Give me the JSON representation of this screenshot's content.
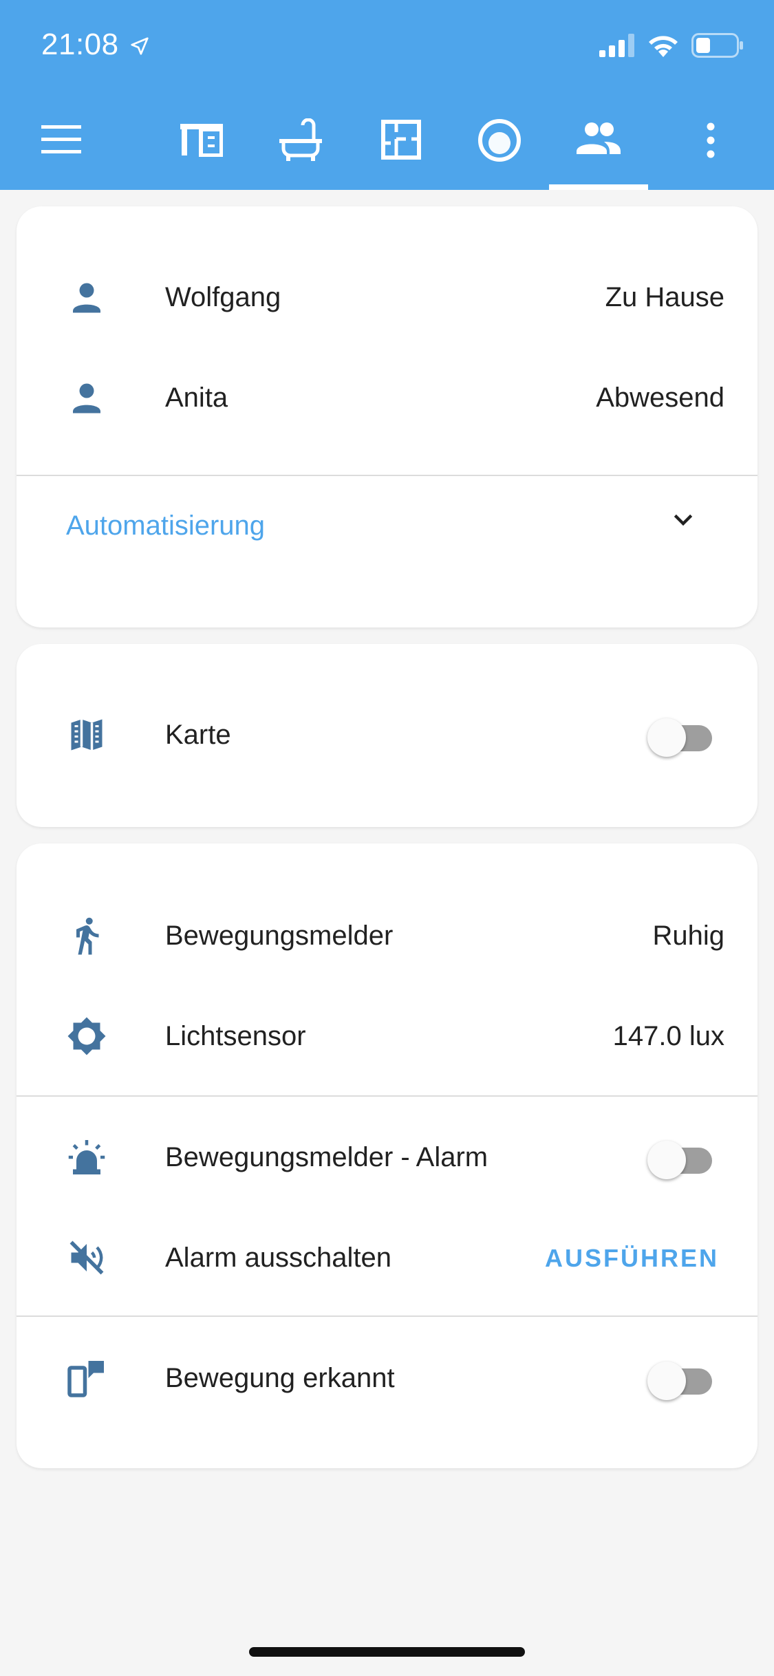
{
  "status_bar": {
    "time": "21:08"
  },
  "colors": {
    "header": "#4ea5eb",
    "icon": "#44739e",
    "accent": "#4ea5eb"
  },
  "toolbar": {
    "icons": [
      "menu-icon",
      "desk-icon",
      "bathtub-icon",
      "floorplan-icon",
      "robot-vacuum-icon",
      "people-icon",
      "more-vert-icon"
    ],
    "active_tab": "people-icon"
  },
  "card_people": {
    "rows": [
      {
        "label": "Wolfgang",
        "value": "Zu Hause",
        "icon": "person-icon"
      },
      {
        "label": "Anita",
        "value": "Abwesend",
        "icon": "person-icon"
      }
    ],
    "footer_link": "Automatisierung"
  },
  "card_map": {
    "label": "Karte",
    "icon": "map-icon",
    "toggle_on": false
  },
  "card_sensors": {
    "rows": [
      {
        "label": "Bewegungsmelder",
        "value": "Ruhig",
        "icon": "walk-icon"
      },
      {
        "label": "Lichtsensor",
        "value": "147.0 lux",
        "icon": "brightness-icon"
      }
    ],
    "alarm": {
      "label": "Bewegungsmelder - Alarm",
      "icon": "alarm-light-icon",
      "toggle_on": false
    },
    "alarm_off": {
      "label": "Alarm ausschalten",
      "icon": "volume-off-icon",
      "action": "AUSFÜHREN"
    },
    "motion": {
      "label": "Bewegung erkannt",
      "icon": "cellphone-message-icon",
      "toggle_on": false
    }
  }
}
